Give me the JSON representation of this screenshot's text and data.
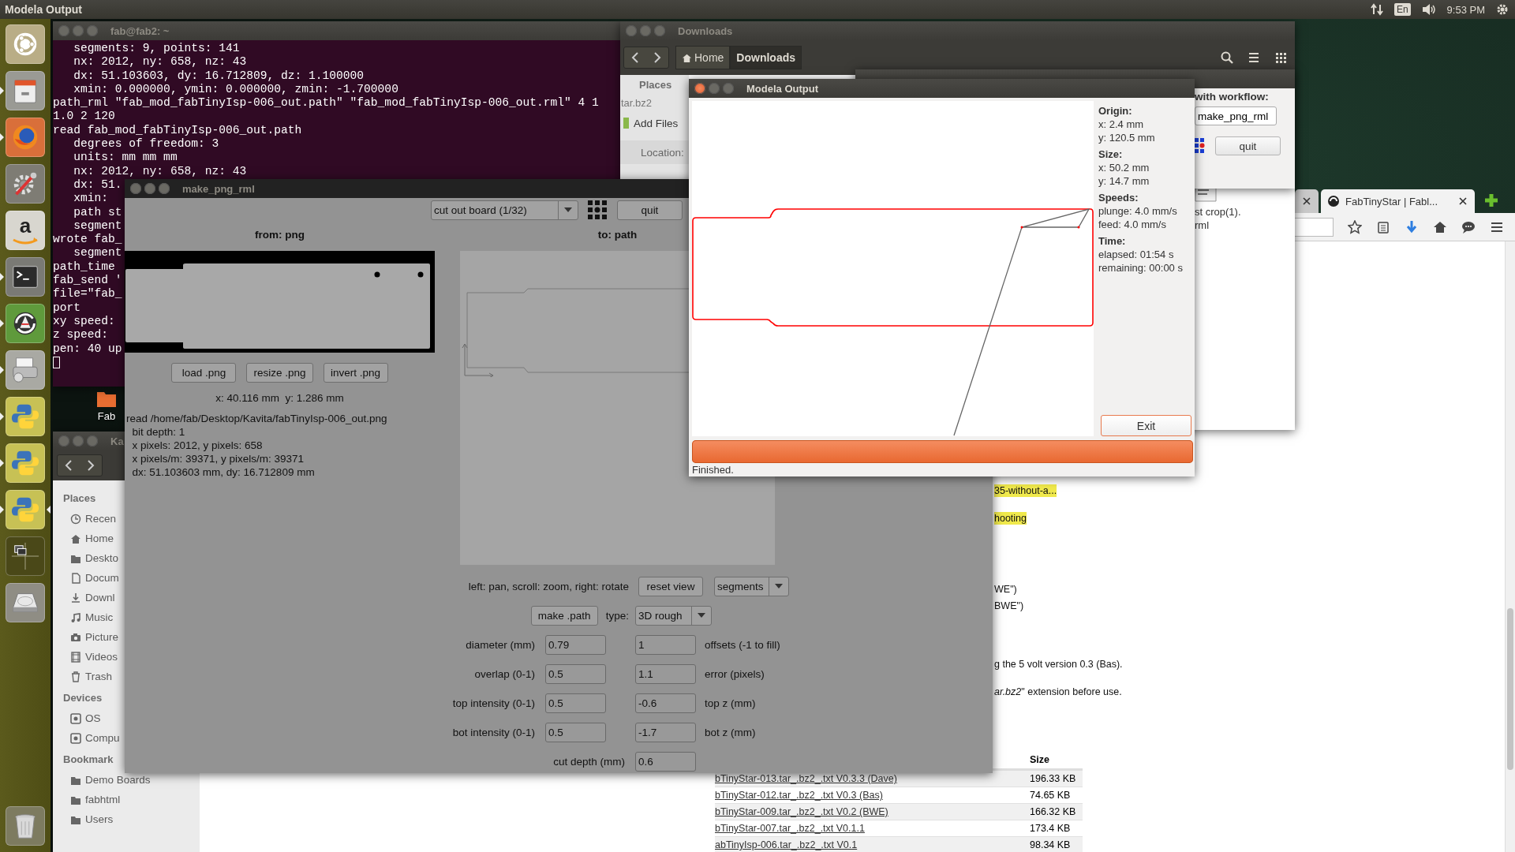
{
  "top_bar": {
    "title": "Modela Output",
    "keyboard_layout": "En",
    "clock": "9:53 PM"
  },
  "launcher": [
    {
      "kind": "ubuntu",
      "running": false,
      "focused": false
    },
    {
      "kind": "files",
      "running": true,
      "focused": false
    },
    {
      "kind": "browser",
      "running": true,
      "focused": false
    },
    {
      "kind": "settings",
      "running": false,
      "focused": false
    },
    {
      "kind": "amazon",
      "glyph": "a",
      "running": false,
      "focused": false
    },
    {
      "kind": "terminal",
      "running": true,
      "focused": false
    },
    {
      "kind": "updater",
      "running": true,
      "focused": false
    },
    {
      "kind": "printer",
      "running": true,
      "focused": false
    },
    {
      "kind": "python",
      "running": true,
      "focused": false
    },
    {
      "kind": "python",
      "running": true,
      "focused": false
    },
    {
      "kind": "python",
      "running": true,
      "focused": true
    },
    {
      "kind": "workspaces",
      "running": false,
      "focused": false
    },
    {
      "kind": "disk",
      "running": false,
      "focused": false
    },
    {
      "kind": "trash",
      "running": false,
      "focused": false
    }
  ],
  "desktop_icons": [
    {
      "label": "Fab"
    }
  ],
  "terminal": {
    "title": "fab@fab2: ~",
    "lines": [
      "   segments: 9, points: 141",
      "   nx: 2012, ny: 658, nz: 43",
      "   dx: 51.103603, dy: 16.712809, dz: 1.100000",
      "   xmin: 0.000000, ymin: 0.000000, zmin: -1.700000",
      "path_rml \"fab_mod_fabTinyIsp-006_out.path\" \"fab_mod_fabTinyIsp-006_out.rml\" 4 1",
      "1.0 2 120",
      "read fab_mod_fabTinyIsp-006_out.path",
      "   degrees of freedom: 3",
      "   units: mm mm mm",
      "   nx: 2012, ny: 658, nz: 43",
      "   dx: 51.",
      "   xmin:",
      "   path st",
      "   segment",
      "wrote fab_",
      "   segment",
      "path_time",
      "fab_send '",
      "file=\"fab_",
      "port",
      "xy speed:",
      "z speed:",
      "pen: 40 up"
    ]
  },
  "file_manager": {
    "title": "Ka",
    "sections": [
      {
        "header": "Places",
        "items": [
          {
            "label": "Recen",
            "kind": "clock"
          },
          {
            "label": "Home",
            "kind": "home"
          },
          {
            "label": "Deskto",
            "kind": "folder"
          },
          {
            "label": "Docum",
            "kind": "document"
          },
          {
            "label": "Downl",
            "kind": "download"
          },
          {
            "label": "Music",
            "kind": "music"
          },
          {
            "label": "Picture",
            "kind": "camera"
          },
          {
            "label": "Videos",
            "kind": "film"
          },
          {
            "label": "Trash",
            "kind": "trash"
          }
        ]
      },
      {
        "header": "Devices",
        "items": [
          {
            "label": "OS",
            "kind": "drive"
          },
          {
            "label": "Compu",
            "kind": "drive"
          }
        ]
      },
      {
        "header": "Bookmark",
        "items": [
          {
            "label": "Demo Boards",
            "kind": "folder"
          },
          {
            "label": "fabhtml",
            "kind": "folder"
          },
          {
            "label": "Users",
            "kind": "folder"
          }
        ]
      }
    ]
  },
  "browser": {
    "tabs": [
      {
        "selected": false
      },
      {
        "title": "FabTinyStar | Fabl...",
        "selected": true
      }
    ],
    "snippets": [
      {
        "text": "35-without-a...",
        "highlighted": true
      },
      {
        "text": "hooting",
        "highlighted": true
      },
      {
        "text": "WE\")",
        "highlighted": false
      },
      {
        "text": "BWE\")",
        "highlighted": false
      },
      {
        "text": "g the 5 volt version 0.3 (Bas).",
        "highlighted": false
      },
      {
        "text": "*ar.bz2*\" extension before use.",
        "highlighted": false
      }
    ],
    "table": {
      "size_header": "Size",
      "rows": [
        {
          "file": "bTinyStar-013.tar_.bz2_.txt V0.3.3 (Dave)",
          "size": "196.33 KB"
        },
        {
          "file": "bTinyStar-012.tar_.bz2_.txt V0.3 (Bas)",
          "size": "74.65 KB"
        },
        {
          "file": "bTinyStar-009.tar_.bz2_.txt V0.2 (BWE)",
          "size": "166.32 KB"
        },
        {
          "file": "bTinyStar-007.tar_.bz2_.txt V0.1.1",
          "size": "173.4 KB"
        },
        {
          "file": "abTinyIsp-006.tar_.bz2_.txt V0.1",
          "size": "98.34 KB"
        }
      ]
    }
  },
  "downloads_window": {
    "title": "Downloads",
    "path": [
      {
        "label": "Home",
        "selected": false
      },
      {
        "label": "Downloads",
        "selected": true
      }
    ],
    "sidebar_header": "Places",
    "file_name": "tar.bz2",
    "add_files": "Add Files",
    "location_label": "Location:",
    "file_caption": "st crop(1).\nrml"
  },
  "workflow_window": {
    "label": "with workflow:",
    "workflow": "make_png_rml",
    "quit": "quit"
  },
  "make_window": {
    "title": "make_png_rml",
    "process": "cut out board (1/32)",
    "quit": "quit",
    "from_label": "from: png",
    "to_label": "to: path",
    "png_buttons": [
      "load .png",
      "resize .png",
      "invert .png"
    ],
    "cursor_position": "x: 40.116 mm  y: 1.286 mm",
    "info_lines": [
      "read /home/fab/Desktop/Kavita/fabTinyIsp-006_out.png",
      "  bit depth: 1",
      "  x pixels: 2012, y pixels: 658",
      "  x pixels/m: 39371, y pixels/m: 39371",
      "  dx: 51.103603 mm, dy: 16.712809 mm"
    ],
    "view_hint": "left: pan, scroll: zoom, right: rotate",
    "reset_view": "reset view",
    "view_mode": "segments",
    "make_path": "make .path",
    "type_label": "type:",
    "type": "3D rough",
    "params": [
      {
        "label": "diameter (mm)",
        "value": "0.79",
        "value_2": "1",
        "label_2": "offsets (-1 to fill)"
      },
      {
        "label": "overlap (0-1)",
        "value": "0.5",
        "value_2": "1.1",
        "label_2": "error (pixels)"
      },
      {
        "label": "top intensity (0-1)",
        "value": "0.5",
        "value_2": "-0.6",
        "label_2": "top z (mm)"
      },
      {
        "label": "bot intensity (0-1)",
        "value": "0.5",
        "value_2": "-1.7",
        "label_2": "bot z (mm)"
      }
    ],
    "cut_depth": {
      "label": "cut depth (mm)",
      "value": "0.6"
    }
  },
  "modela_window": {
    "title": "Modela Output",
    "info": [
      {
        "heading": "Origin:",
        "lines": [
          "x: 2.4 mm",
          "y: 120.5 mm"
        ]
      },
      {
        "heading": "Size:",
        "lines": [
          "x: 50.2 mm",
          "y: 14.7 mm"
        ]
      },
      {
        "heading": "Speeds:",
        "lines": [
          "plunge: 4.0 mm/s",
          "feed: 4.0 mm/s"
        ]
      },
      {
        "heading": "Time:",
        "lines": [
          "elapsed: 01:54 s",
          "remaining: 00:00 s"
        ]
      }
    ],
    "exit": "Exit",
    "progress": {
      "level": 1
    },
    "status": "Finished."
  }
}
